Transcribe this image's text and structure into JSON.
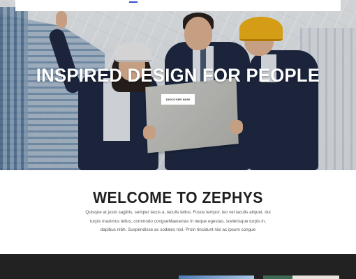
{
  "hero": {
    "title": "INSPIRED DESIGN FOR PEOPLE",
    "button_label": "DISCOVER NOW"
  },
  "welcome": {
    "title": "WELCOME TO ZEPHYS",
    "text": "Quisque at justo sagittis, semper lacus a, iaculis tellus. Fusce tempor, leo vel iaculis aliquet, dui turpis maximus tellus, commodo congueMaecenas in neque egestas, scelerisque turpis in, dapibus nibh. Suspendisse ac sodales nisl. Proin tincidunt nisl ac ipsum congue"
  },
  "colors": {
    "accent": "#3b4bd8",
    "dark_section": "#222222",
    "title_text": "#1f1f1f"
  }
}
